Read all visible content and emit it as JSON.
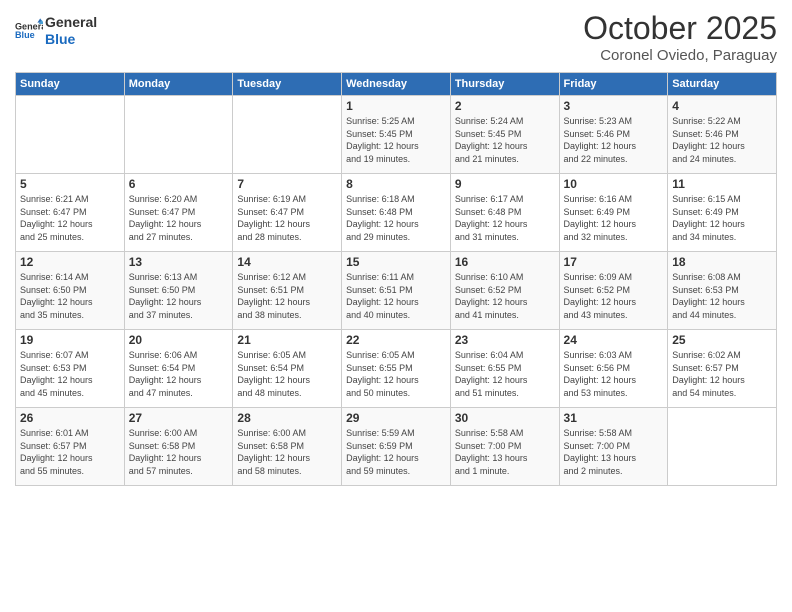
{
  "header": {
    "logo_line1": "General",
    "logo_line2": "Blue",
    "month": "October 2025",
    "location": "Coronel Oviedo, Paraguay"
  },
  "days_of_week": [
    "Sunday",
    "Monday",
    "Tuesday",
    "Wednesday",
    "Thursday",
    "Friday",
    "Saturday"
  ],
  "weeks": [
    [
      {
        "day": "",
        "info": ""
      },
      {
        "day": "",
        "info": ""
      },
      {
        "day": "",
        "info": ""
      },
      {
        "day": "1",
        "info": "Sunrise: 5:25 AM\nSunset: 5:45 PM\nDaylight: 12 hours\nand 19 minutes."
      },
      {
        "day": "2",
        "info": "Sunrise: 5:24 AM\nSunset: 5:45 PM\nDaylight: 12 hours\nand 21 minutes."
      },
      {
        "day": "3",
        "info": "Sunrise: 5:23 AM\nSunset: 5:46 PM\nDaylight: 12 hours\nand 22 minutes."
      },
      {
        "day": "4",
        "info": "Sunrise: 5:22 AM\nSunset: 5:46 PM\nDaylight: 12 hours\nand 24 minutes."
      }
    ],
    [
      {
        "day": "5",
        "info": "Sunrise: 6:21 AM\nSunset: 6:47 PM\nDaylight: 12 hours\nand 25 minutes."
      },
      {
        "day": "6",
        "info": "Sunrise: 6:20 AM\nSunset: 6:47 PM\nDaylight: 12 hours\nand 27 minutes."
      },
      {
        "day": "7",
        "info": "Sunrise: 6:19 AM\nSunset: 6:47 PM\nDaylight: 12 hours\nand 28 minutes."
      },
      {
        "day": "8",
        "info": "Sunrise: 6:18 AM\nSunset: 6:48 PM\nDaylight: 12 hours\nand 29 minutes."
      },
      {
        "day": "9",
        "info": "Sunrise: 6:17 AM\nSunset: 6:48 PM\nDaylight: 12 hours\nand 31 minutes."
      },
      {
        "day": "10",
        "info": "Sunrise: 6:16 AM\nSunset: 6:49 PM\nDaylight: 12 hours\nand 32 minutes."
      },
      {
        "day": "11",
        "info": "Sunrise: 6:15 AM\nSunset: 6:49 PM\nDaylight: 12 hours\nand 34 minutes."
      }
    ],
    [
      {
        "day": "12",
        "info": "Sunrise: 6:14 AM\nSunset: 6:50 PM\nDaylight: 12 hours\nand 35 minutes."
      },
      {
        "day": "13",
        "info": "Sunrise: 6:13 AM\nSunset: 6:50 PM\nDaylight: 12 hours\nand 37 minutes."
      },
      {
        "day": "14",
        "info": "Sunrise: 6:12 AM\nSunset: 6:51 PM\nDaylight: 12 hours\nand 38 minutes."
      },
      {
        "day": "15",
        "info": "Sunrise: 6:11 AM\nSunset: 6:51 PM\nDaylight: 12 hours\nand 40 minutes."
      },
      {
        "day": "16",
        "info": "Sunrise: 6:10 AM\nSunset: 6:52 PM\nDaylight: 12 hours\nand 41 minutes."
      },
      {
        "day": "17",
        "info": "Sunrise: 6:09 AM\nSunset: 6:52 PM\nDaylight: 12 hours\nand 43 minutes."
      },
      {
        "day": "18",
        "info": "Sunrise: 6:08 AM\nSunset: 6:53 PM\nDaylight: 12 hours\nand 44 minutes."
      }
    ],
    [
      {
        "day": "19",
        "info": "Sunrise: 6:07 AM\nSunset: 6:53 PM\nDaylight: 12 hours\nand 45 minutes."
      },
      {
        "day": "20",
        "info": "Sunrise: 6:06 AM\nSunset: 6:54 PM\nDaylight: 12 hours\nand 47 minutes."
      },
      {
        "day": "21",
        "info": "Sunrise: 6:05 AM\nSunset: 6:54 PM\nDaylight: 12 hours\nand 48 minutes."
      },
      {
        "day": "22",
        "info": "Sunrise: 6:05 AM\nSunset: 6:55 PM\nDaylight: 12 hours\nand 50 minutes."
      },
      {
        "day": "23",
        "info": "Sunrise: 6:04 AM\nSunset: 6:55 PM\nDaylight: 12 hours\nand 51 minutes."
      },
      {
        "day": "24",
        "info": "Sunrise: 6:03 AM\nSunset: 6:56 PM\nDaylight: 12 hours\nand 53 minutes."
      },
      {
        "day": "25",
        "info": "Sunrise: 6:02 AM\nSunset: 6:57 PM\nDaylight: 12 hours\nand 54 minutes."
      }
    ],
    [
      {
        "day": "26",
        "info": "Sunrise: 6:01 AM\nSunset: 6:57 PM\nDaylight: 12 hours\nand 55 minutes."
      },
      {
        "day": "27",
        "info": "Sunrise: 6:00 AM\nSunset: 6:58 PM\nDaylight: 12 hours\nand 57 minutes."
      },
      {
        "day": "28",
        "info": "Sunrise: 6:00 AM\nSunset: 6:58 PM\nDaylight: 12 hours\nand 58 minutes."
      },
      {
        "day": "29",
        "info": "Sunrise: 5:59 AM\nSunset: 6:59 PM\nDaylight: 12 hours\nand 59 minutes."
      },
      {
        "day": "30",
        "info": "Sunrise: 5:58 AM\nSunset: 7:00 PM\nDaylight: 13 hours\nand 1 minute."
      },
      {
        "day": "31",
        "info": "Sunrise: 5:58 AM\nSunset: 7:00 PM\nDaylight: 13 hours\nand 2 minutes."
      },
      {
        "day": "",
        "info": ""
      }
    ]
  ]
}
